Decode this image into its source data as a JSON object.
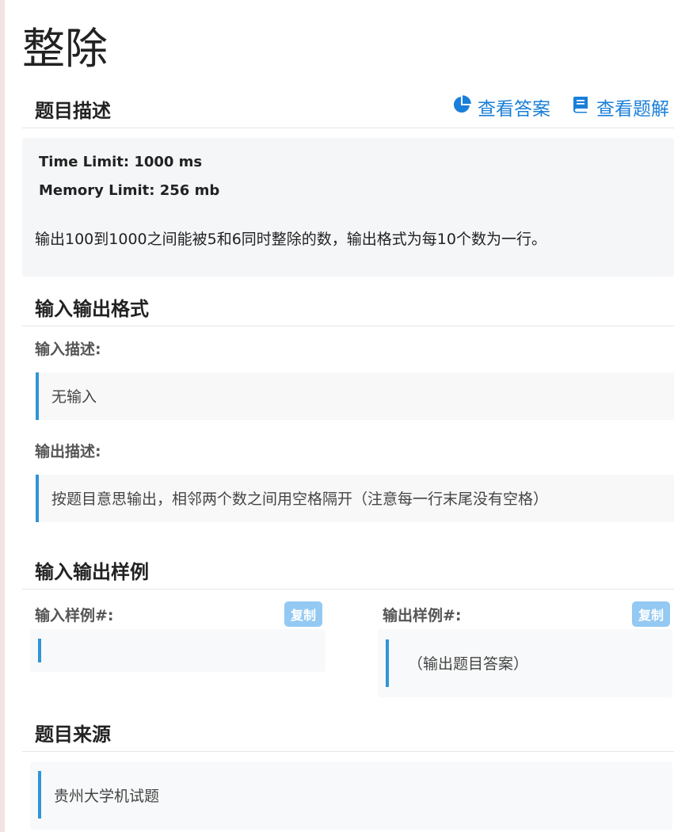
{
  "problem": {
    "title": "整除"
  },
  "description": {
    "heading": "题目描述",
    "view_answer": "查看答案",
    "view_solution": "查看题解",
    "time_limit": "Time Limit: 1000 ms",
    "memory_limit": "Memory Limit: 256 mb",
    "text": "输出100到1000之间能被5和6同时整除的数，输出格式为每10个数为一行。"
  },
  "io_format": {
    "heading": "输入输出格式",
    "input_label": "输入描述:",
    "input_text": "无输入",
    "output_label": "输出描述:",
    "output_text": "按题目意思输出，相邻两个数之间用空格隔开（注意每一行末尾没有空格）"
  },
  "samples": {
    "heading": "输入输出样例",
    "input_label": "输入样例#:",
    "output_label": "输出样例#:",
    "copy": "复制",
    "input_value": "",
    "output_value": "（输出题目答案）"
  },
  "source": {
    "heading": "题目来源",
    "text": "贵州大学机试题"
  },
  "colors": {
    "accent": "#1a7fd9",
    "quote_border": "#2f95d8",
    "copy_button": "#93c9f2"
  }
}
